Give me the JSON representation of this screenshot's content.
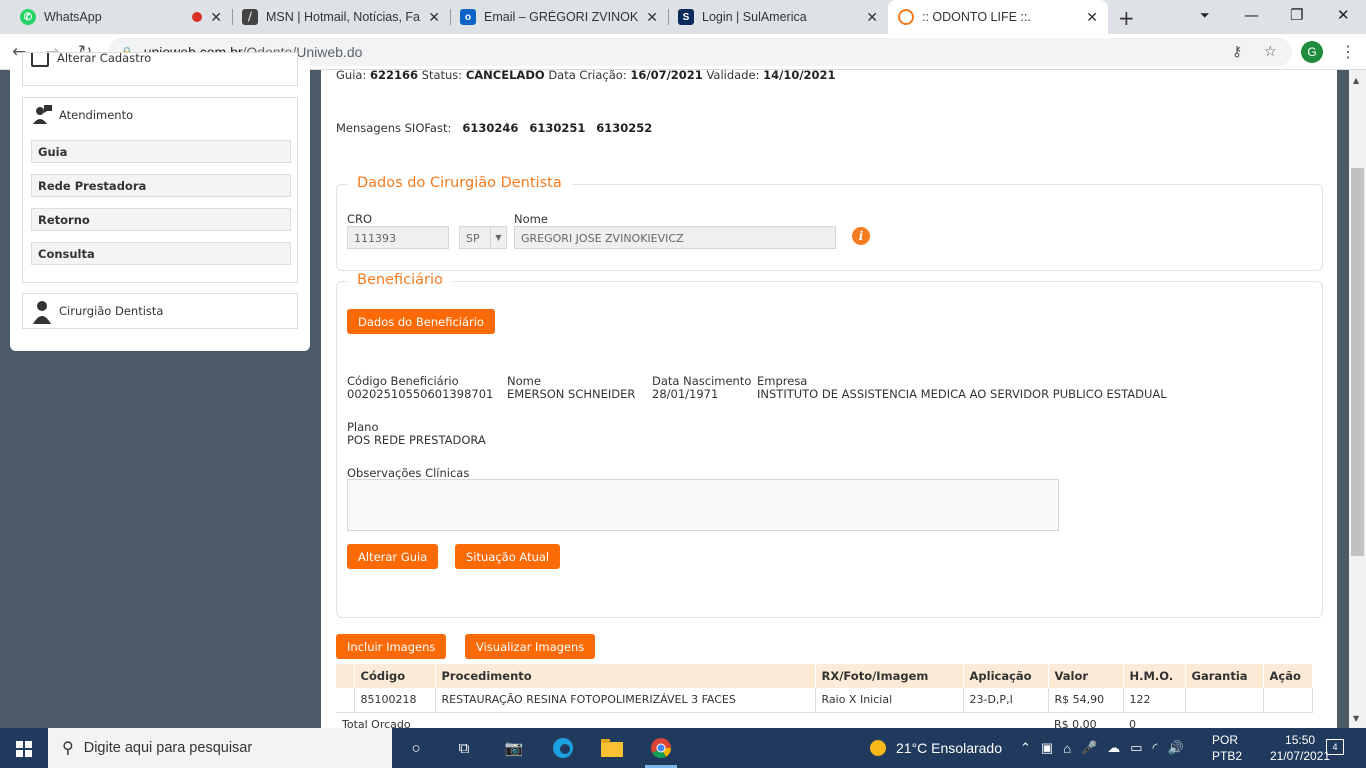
{
  "browser": {
    "tabs": [
      {
        "title": "WhatsApp",
        "icon": "whatsapp-icon",
        "color": "#25d366"
      },
      {
        "title": "MSN | Hotmail, Notícias, Fam",
        "icon": "msn-icon",
        "color": "#333333"
      },
      {
        "title": "Email – GRÉGORI ZVINOKIEVI",
        "icon": "outlook-icon",
        "color": "#0a64c8"
      },
      {
        "title": "Login | SulAmerica",
        "icon": "sulamerica-icon",
        "color": "#0b2a5c"
      },
      {
        "title": ":: ODONTO LIFE ::.",
        "icon": "odontolife-icon",
        "color": "#f47b20"
      }
    ],
    "url_domain": "unioweb.com.br",
    "url_path": "/Odonto/Uniweb.do",
    "profile_initial": "G"
  },
  "sidebar": {
    "alterar_cadastro": "Alterar Cadastro",
    "atendimento_title": "Atendimento",
    "items": [
      "Guia",
      "Rede Prestadora",
      "Retorno",
      "Consulta"
    ],
    "cirurgiao_title": "Cirurgião Dentista"
  },
  "guia": {
    "guia_label": "Guia:",
    "guia_value": "622166",
    "status_label": "Status:",
    "status_value": "CANCELADO",
    "data_criacao_label": "Data Criação:",
    "data_criacao_value": "16/07/2021",
    "validade_label": "Validade:",
    "validade_value": "14/10/2021",
    "mensagens_label": "Mensagens SIOFast:",
    "mensagens": [
      "6130246",
      "6130251",
      "6130252"
    ]
  },
  "dentista": {
    "legend": "Dados do Cirurgião Dentista",
    "cro_label": "CRO",
    "cro_value": "111393",
    "uf_value": "SP",
    "nome_label": "Nome",
    "nome_value": "GREGORI JOSE ZVINOKIEVICZ",
    "info_glyph": "i"
  },
  "beneficiario": {
    "legend": "Beneficiário",
    "dados_button": "Dados do Beneficiário",
    "codigo_label": "Código Beneficiário",
    "codigo_value": "00202510550601398701",
    "nome_label": "Nome",
    "nome_value": "EMERSON SCHNEIDER",
    "nascimento_label": "Data Nascimento",
    "nascimento_value": "28/01/1971",
    "empresa_label": "Empresa",
    "empresa_value": "INSTITUTO DE ASSISTENCIA MEDICA AO SERVIDOR PUBLICO ESTADUAL",
    "plano_label": "Plano",
    "plano_value": "POS REDE PRESTADORA",
    "observacoes_label": "Observações Clínicas",
    "alterar_button": "Alterar Guia",
    "situacao_button": "Situação Atual"
  },
  "imagens": {
    "incluir_button": "Incluir Imagens",
    "visualizar_button": "Visualizar Imagens"
  },
  "procedimentos": {
    "headers": [
      "Código",
      "Procedimento",
      "RX/Foto/Imagem",
      "Aplicação",
      "Valor",
      "H.M.O.",
      "Garantia",
      "Ação"
    ],
    "rows": [
      {
        "codigo": "85100218",
        "procedimento": "RESTAURAÇÃO RESINA FOTOPOLIMERIZÁVEL 3 FACES",
        "rx": "Raio X Inicial",
        "aplicacao": "23-D,P,I",
        "valor": "R$ 54,90",
        "hmo": "122",
        "garantia": "",
        "acao": ""
      }
    ],
    "total_label": "Total Orçado",
    "total_valor": "R$ 0,00",
    "total_hmo": "0"
  },
  "taskbar": {
    "search_placeholder": "Digite aqui para pesquisar",
    "weather": "21°C  Ensolarado",
    "lang_line1": "POR",
    "lang_line2": "PTB2",
    "time": "15:50",
    "date": "21/07/2021",
    "notifications": "4"
  }
}
